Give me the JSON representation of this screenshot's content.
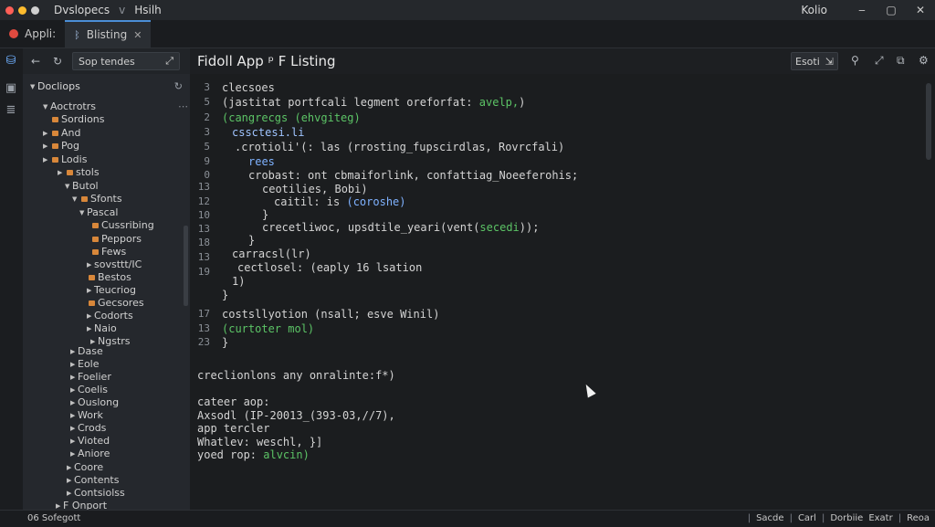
{
  "titlebar": {
    "menu_primary": "Dvslopecs",
    "menu_chevron": "v",
    "menu_secondary": "Hsilh",
    "user": "Kolio",
    "minimize": "‒",
    "maximize": "▢",
    "close": "✕"
  },
  "tabs": [
    {
      "label": "Appli:"
    },
    {
      "label": "Blisting"
    }
  ],
  "sidebar_toolbar": {
    "search_value": "Sop tendes",
    "search_action": "⤢"
  },
  "tree": {
    "header": "Docliops",
    "items": [
      {
        "label": "Aoctrotrs"
      },
      {
        "label": "Sordions"
      },
      {
        "label": "And"
      },
      {
        "label": "Pog"
      },
      {
        "label": "Lodis"
      },
      {
        "label": "stols"
      },
      {
        "label": "Butol"
      },
      {
        "label": "Sfonts"
      },
      {
        "label": "Pascal"
      },
      {
        "label": "Cussribing"
      },
      {
        "label": "Peppors"
      },
      {
        "label": "Fews"
      },
      {
        "label": "sovsttt/IC"
      },
      {
        "label": "Bestos"
      },
      {
        "label": "Teucriog"
      },
      {
        "label": "Gecsores"
      },
      {
        "label": "Codorts"
      },
      {
        "label": "Naio"
      },
      {
        "label": "Ngstrs"
      },
      {
        "label": "Dase"
      },
      {
        "label": "Eole"
      },
      {
        "label": "Foelier"
      },
      {
        "label": "Coelis"
      },
      {
        "label": "Ouslong"
      },
      {
        "label": "Work"
      },
      {
        "label": "Crods"
      },
      {
        "label": "Vioted"
      },
      {
        "label": "Aniore"
      },
      {
        "label": "Coore"
      },
      {
        "label": "Contents"
      },
      {
        "label": "Contsiolss"
      },
      {
        "label": "F Onport"
      }
    ]
  },
  "editor": {
    "title": "Fidoll App ᵖ F Listing",
    "header_button": "Esoti",
    "line_numbers": [
      "3",
      "5",
      "2",
      "3",
      "5",
      "9",
      "0",
      "13",
      "12",
      "10",
      "13",
      "18",
      "13",
      "19",
      "17",
      "13",
      "23"
    ],
    "lines": [
      "clecsoes",
      "(jastitat portfcali legment oreforfat: ",
      "(cangrecgs (ehvgiteg)",
      "cssctesi.li",
      ".crotioli'(: las (rrosting_fupscirdlas, Rovrcfali)",
      "rees",
      "crobast: ont cbmaiforlink, confattiag_Noeeferohis;",
      "ceotilies, Bobi)",
      "caitil: is ",
      "crecetliwoc, upsdtile_yeari(vent(",
      "}",
      "carracsl(lr)",
      "cectlosel: (eaply 16 lsation",
      "1)",
      "}",
      "costsllyotion (nsall; esve Winil)",
      "(curtoter mol)",
      "}",
      "creclionlons any onralinte:f*)",
      "cateer aop:",
      "Axsodl (IP-20013_(393-03,//7),",
      "app tercler",
      "Whatlev: weschl, }]",
      "yoed rop: "
    ],
    "inline": {
      "valid": "avelp,",
      "coroshe": "(coroshe)",
      "secedi": "secedi",
      "stcvin": "alvcin)"
    }
  },
  "statusbar": {
    "left": "06 Sofegott",
    "right": [
      "Sacde",
      "Carl",
      "Dorbiie",
      "Exatr",
      "Reoa"
    ]
  }
}
